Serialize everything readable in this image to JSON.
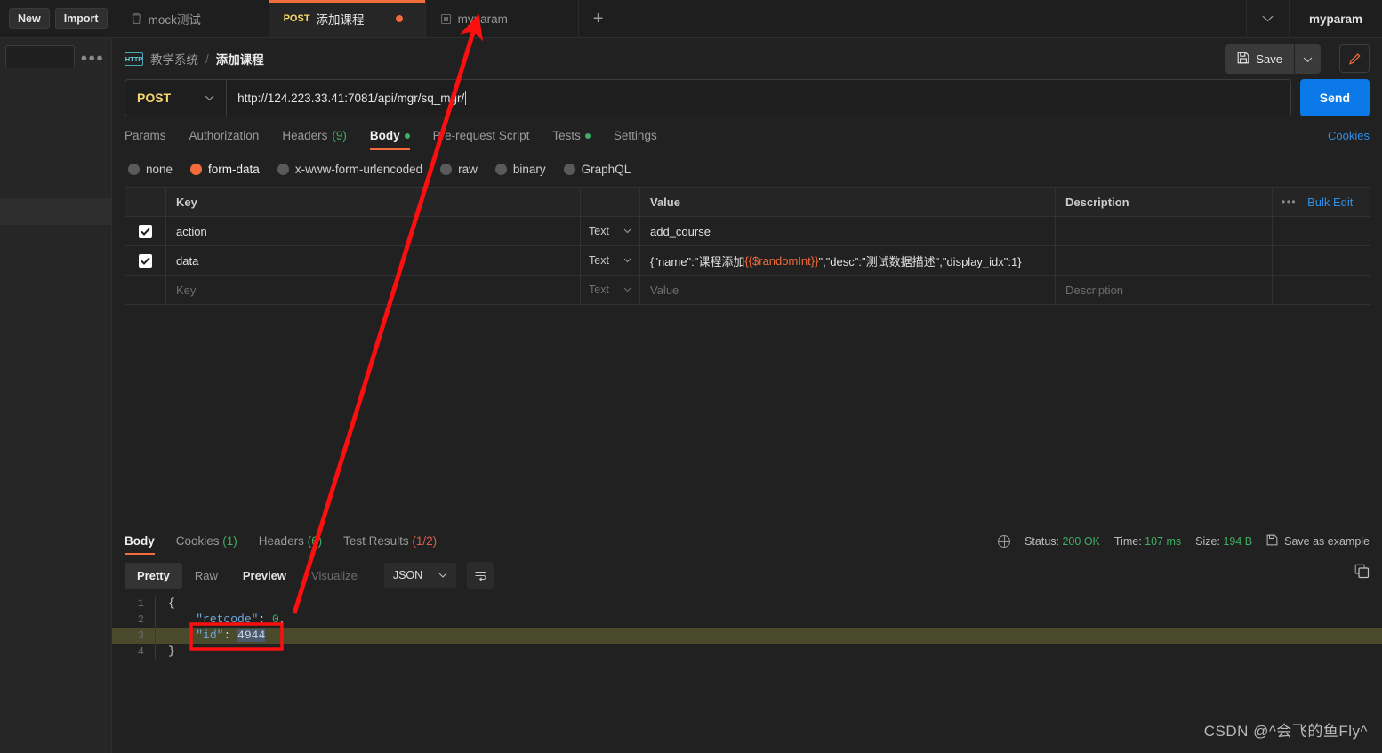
{
  "topbar": {
    "new_label": "New",
    "import_label": "Import",
    "tabs": [
      {
        "icon": "trash-icon",
        "method": "",
        "title": "mock测试",
        "active": false,
        "unsaved": false
      },
      {
        "icon": "",
        "method": "POST",
        "title": "添加课程",
        "active": true,
        "unsaved": true
      },
      {
        "icon": "square-icon",
        "method": "",
        "title": "myparam",
        "active": false,
        "unsaved": false
      }
    ],
    "add_tab_label": "+",
    "environment": "myparam"
  },
  "breadcrumb": {
    "protocol_badge": "HTTP",
    "parent": "教学系统",
    "separator": "/",
    "current": "添加课程"
  },
  "actions": {
    "save_label": "Save",
    "save_caret": "⌄",
    "edit_icon": "pencil-icon"
  },
  "request": {
    "method": "POST",
    "url": "http://124.223.33.41:7081/api/mgr/sq_mgr/",
    "send_label": "Send",
    "tabs": [
      {
        "label": "Params",
        "count": "",
        "dot": false,
        "active": false
      },
      {
        "label": "Authorization",
        "count": "",
        "dot": false,
        "active": false
      },
      {
        "label": "Headers",
        "count": "(9)",
        "dot": false,
        "active": false
      },
      {
        "label": "Body",
        "count": "",
        "dot": true,
        "active": true
      },
      {
        "label": "Pre-request Script",
        "count": "",
        "dot": false,
        "active": false
      },
      {
        "label": "Tests",
        "count": "",
        "dot": true,
        "active": false
      },
      {
        "label": "Settings",
        "count": "",
        "dot": false,
        "active": false
      }
    ],
    "cookies_link": "Cookies",
    "body_types": [
      {
        "label": "none",
        "selected": false
      },
      {
        "label": "form-data",
        "selected": true
      },
      {
        "label": "x-www-form-urlencoded",
        "selected": false
      },
      {
        "label": "raw",
        "selected": false
      },
      {
        "label": "binary",
        "selected": false
      },
      {
        "label": "GraphQL",
        "selected": false
      }
    ],
    "table": {
      "headers": {
        "key": "Key",
        "value": "Value",
        "description": "Description"
      },
      "bulk_edit_label": "Bulk Edit",
      "rows": [
        {
          "checked": true,
          "key": "action",
          "type": "Text",
          "value_plain": "add_course",
          "value_pre": "",
          "value_token": "",
          "value_post": "",
          "description": ""
        },
        {
          "checked": true,
          "key": "data",
          "type": "Text",
          "value_plain": "",
          "value_pre": "{\"name\":\"课程添加",
          "value_token": "{{$randomInt}}",
          "value_post": "\",\"desc\":\"测试数据描述\",\"display_idx\":1}",
          "description": ""
        }
      ],
      "empty_row": {
        "key_placeholder": "Key",
        "type_placeholder": "Text",
        "value_placeholder": "Value",
        "description_placeholder": "Description"
      }
    }
  },
  "response": {
    "tabs": [
      {
        "label": "Body",
        "count": "",
        "count_color": "",
        "active": true
      },
      {
        "label": "Cookies",
        "count": "(1)",
        "count_color": "green",
        "active": false
      },
      {
        "label": "Headers",
        "count": "(6)",
        "count_color": "green",
        "active": false
      },
      {
        "label": "Test Results",
        "count": "(1/2)",
        "count_color": "red",
        "active": false
      }
    ],
    "meta": {
      "status_label": "Status:",
      "status_value": "200 OK",
      "time_label": "Time:",
      "time_value": "107 ms",
      "size_label": "Size:",
      "size_value": "194 B",
      "save_example_label": "Save as example"
    },
    "view_modes": [
      {
        "label": "Pretty",
        "active": true,
        "dim": false,
        "bold": false
      },
      {
        "label": "Raw",
        "active": false,
        "dim": false,
        "bold": false
      },
      {
        "label": "Preview",
        "active": false,
        "dim": false,
        "bold": true
      },
      {
        "label": "Visualize",
        "active": false,
        "dim": true,
        "bold": false
      }
    ],
    "format": "JSON",
    "wrap_icon": "wrap-lines-icon",
    "copy_icon": "copy-icon",
    "code_lines": [
      {
        "n": "1",
        "parts": [
          {
            "t": "{",
            "c": "p"
          }
        ],
        "highlight": false
      },
      {
        "n": "2",
        "parts": [
          {
            "t": "    ",
            "c": "p"
          },
          {
            "t": "\"retcode\"",
            "c": "key"
          },
          {
            "t": ": ",
            "c": "p"
          },
          {
            "t": "0",
            "c": "num"
          },
          {
            "t": ",",
            "c": "p"
          }
        ],
        "highlight": false
      },
      {
        "n": "3",
        "parts": [
          {
            "t": "    ",
            "c": "p"
          },
          {
            "t": "\"id\"",
            "c": "key"
          },
          {
            "t": ": ",
            "c": "p"
          },
          {
            "t": "4944",
            "c": "numsel"
          }
        ],
        "highlight": true
      },
      {
        "n": "4",
        "parts": [
          {
            "t": "}",
            "c": "p"
          }
        ],
        "highlight": false
      }
    ]
  },
  "watermark": "CSDN @^会飞的鱼Fly^",
  "colors": {
    "accent_orange": "#f26b3a",
    "send_blue": "#0b79e8",
    "method_yellow": "#f5d76e",
    "green": "#3fae62",
    "red_annotation": "#fb0f0f",
    "highlight_row": "#4a4a2c"
  }
}
